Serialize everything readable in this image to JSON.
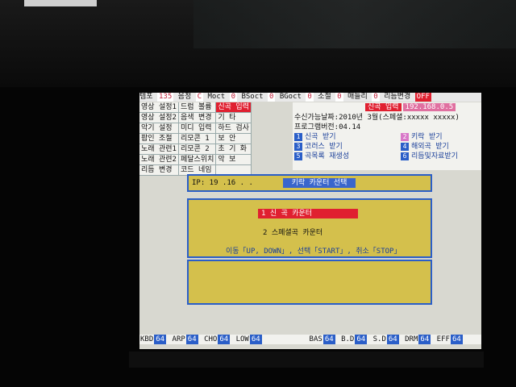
{
  "top_bar": [
    {
      "label": "템포",
      "value": "135"
    },
    {
      "label": "음정",
      "value": "C"
    },
    {
      "label": "Moct",
      "value": "0"
    },
    {
      "label": "BSoct",
      "value": "0"
    },
    {
      "label": "BGoct",
      "value": "0"
    },
    {
      "label": "소절",
      "value": "0"
    },
    {
      "label": "매들리",
      "value": "0"
    },
    {
      "label": "리듬변경",
      "value": "OFF"
    }
  ],
  "menu": [
    [
      "영상 설정1",
      "드럼 볼륨",
      "신곡 입력"
    ],
    [
      "영상 설정2",
      "음색 변경",
      "기 타"
    ],
    [
      "악기 설정",
      "미디 입력",
      "하드 검사"
    ],
    [
      "팝인 조절",
      "리모콘 1",
      "보 안"
    ],
    [
      "노래 관련1",
      "리모콘 2",
      "초 기 화"
    ],
    [
      "노래 관련2",
      "페달스위치",
      "악 보"
    ],
    [
      "리듬 변경",
      "코드 네임",
      ""
    ]
  ],
  "info": {
    "head_label": "신곡 입력",
    "head_ip": "192.168.0.5",
    "receive_date": "수신가능날짜:2010년 3월(스페셜:xxxxx xxxxx)",
    "program_version": "프로그램버전:04.14",
    "options": [
      {
        "num": "1",
        "label": "신곡 받기"
      },
      {
        "num": "2",
        "label": "키락 받기"
      },
      {
        "num": "3",
        "label": "코러스 받기"
      },
      {
        "num": "4",
        "label": "해외곡 받기"
      },
      {
        "num": "5",
        "label": "곡목록 재생성"
      },
      {
        "num": "6",
        "label": "리듬및자료받기"
      }
    ]
  },
  "ip_box": {
    "label": "IP: 19 .16 . . ",
    "button": "키락 카운터 선택"
  },
  "counter_panel": {
    "item1": "1 신 곡 카운터",
    "item2": "2 스페셜곡 카운터",
    "help": "이동「UP, DOWN」, 선택「START」, 취소「STOP」"
  },
  "bottom_bar": [
    {
      "label": "KBD",
      "value": "64"
    },
    {
      "label": "ARP",
      "value": "64"
    },
    {
      "label": "CHO",
      "value": "64"
    },
    {
      "label": "LOW",
      "value": "64"
    },
    {
      "label": "BAS",
      "value": "64"
    },
    {
      "label": "B.D",
      "value": "64"
    },
    {
      "label": "S.D",
      "value": "64"
    },
    {
      "label": "DRM",
      "value": "64"
    },
    {
      "label": "EFF",
      "value": "64"
    }
  ]
}
